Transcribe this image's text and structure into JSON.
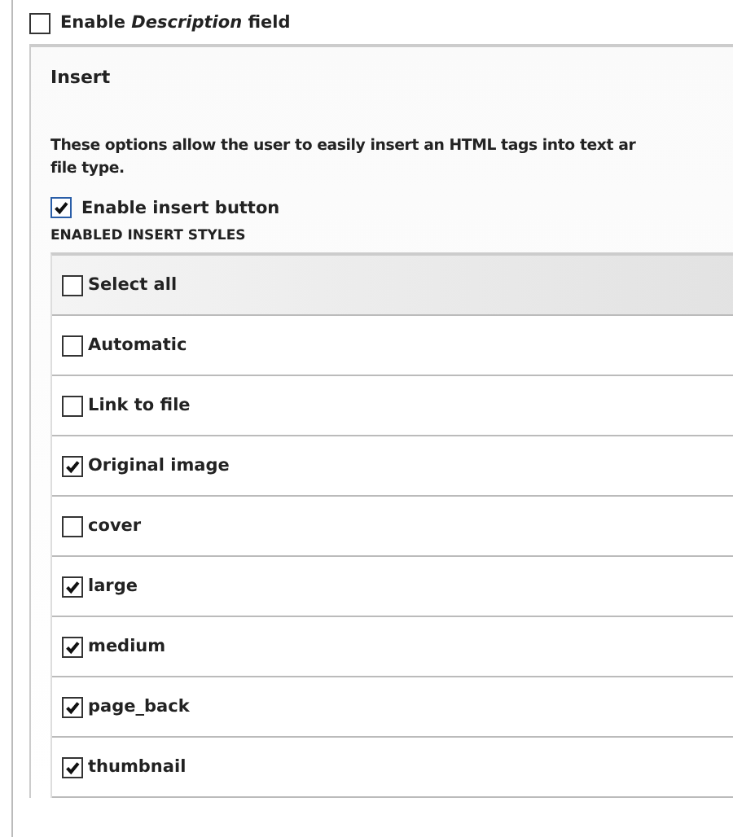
{
  "description_option": {
    "label": "Enable *Description* field",
    "checked": false
  },
  "fieldset": {
    "legend": "Insert",
    "description": "These options allow the user to easily insert an HTML tags into text ar\nfile type.",
    "insert_button_option": {
      "label": "Enable insert button",
      "checked": true
    },
    "styles_heading": "ENABLED INSERT STYLES",
    "styles": [
      {
        "label": "Select all",
        "checked": false,
        "kind": "header"
      },
      {
        "label": "Automatic",
        "checked": false,
        "kind": "row"
      },
      {
        "label": "Link to file",
        "checked": false,
        "kind": "row"
      },
      {
        "label": "Original image",
        "checked": true,
        "kind": "row"
      },
      {
        "label": "cover",
        "checked": false,
        "kind": "row"
      },
      {
        "label": "large",
        "checked": true,
        "kind": "row"
      },
      {
        "label": "medium",
        "checked": true,
        "kind": "row"
      },
      {
        "label": "page_back",
        "checked": true,
        "kind": "row"
      },
      {
        "label": "thumbnail",
        "checked": true,
        "kind": "row"
      }
    ]
  }
}
